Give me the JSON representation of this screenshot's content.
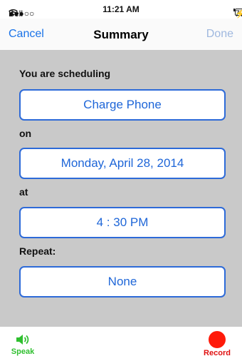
{
  "status_bar": {
    "signal_dots": "●●●○○",
    "carrier": "Bell",
    "wifi_icon": "wifi-icon",
    "time": "11:21 AM",
    "battery_percent": "77%",
    "battery_level": 0.77,
    "charging_icon": "bolt-icon"
  },
  "nav": {
    "cancel_label": "Cancel",
    "title": "Summary",
    "done_label": "Done"
  },
  "form": {
    "scheduling_label": "You are scheduling",
    "task_value": "Charge Phone",
    "on_label": "on",
    "date_value": "Monday, April 28, 2014",
    "at_label": "at",
    "time_value": "4 : 30 PM",
    "repeat_label": "Repeat:",
    "repeat_value": "None"
  },
  "bottom_bar": {
    "speak_label": "Speak",
    "speak_icon": "speaker-icon",
    "record_label": "Record",
    "record_icon": "record-dot-icon"
  },
  "colors": {
    "accent": "#1e66d8",
    "content_background": "#c9c9c9",
    "speak_green": "#2fbf2f",
    "record_red": "#ff1a0a"
  }
}
